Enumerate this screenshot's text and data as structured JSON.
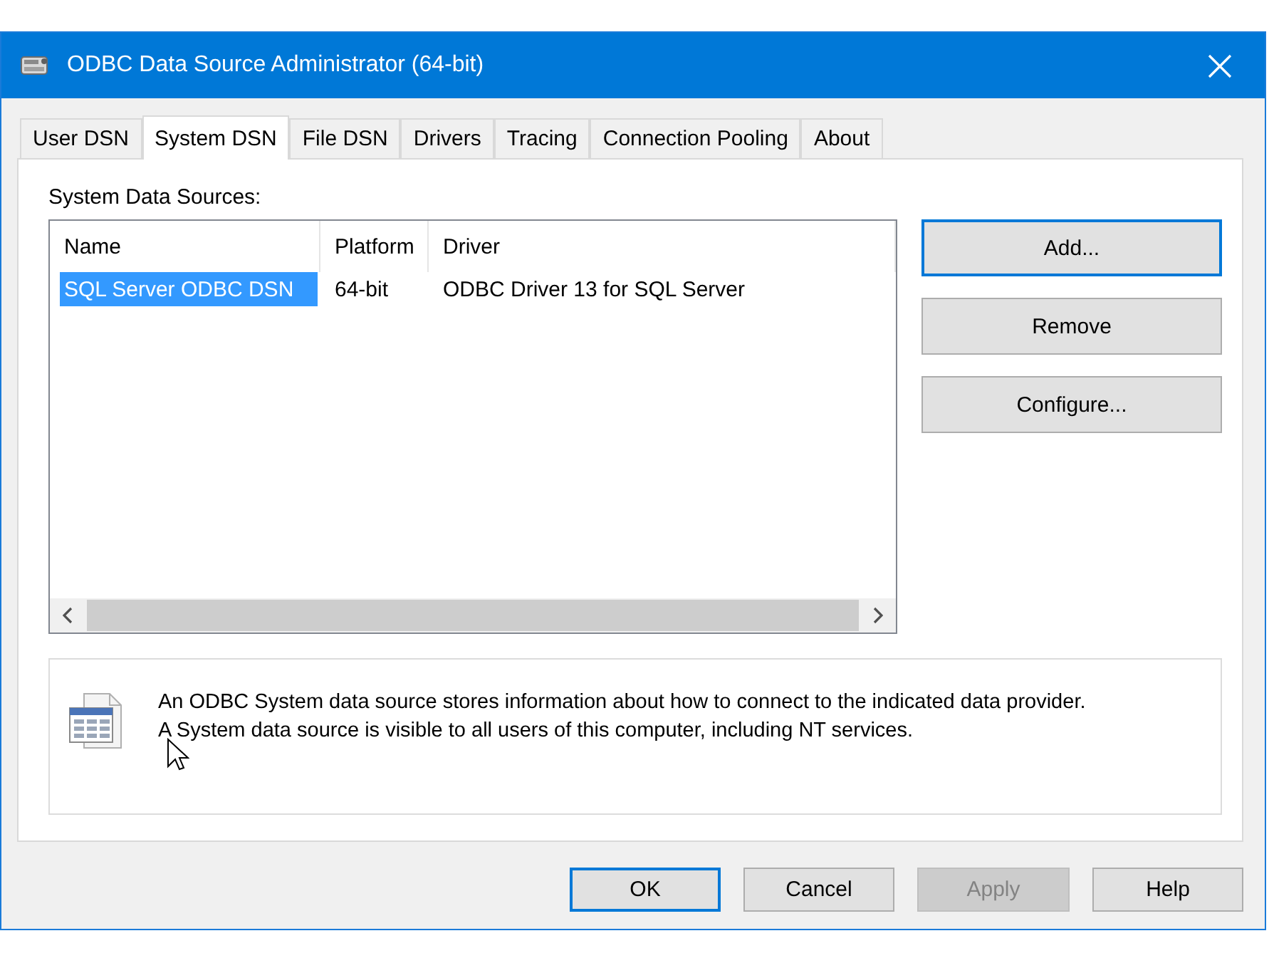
{
  "window": {
    "title": "ODBC Data Source Administrator (64-bit)"
  },
  "tabs": [
    {
      "label": "User DSN",
      "selected": false
    },
    {
      "label": "System DSN",
      "selected": true
    },
    {
      "label": "File DSN",
      "selected": false
    },
    {
      "label": "Drivers",
      "selected": false
    },
    {
      "label": "Tracing",
      "selected": false
    },
    {
      "label": "Connection Pooling",
      "selected": false
    },
    {
      "label": "About",
      "selected": false
    }
  ],
  "list": {
    "label": "System Data Sources:",
    "columns": [
      "Name",
      "Platform",
      "Driver"
    ],
    "rows": [
      {
        "cells": [
          "SQL Server ODBC DSN",
          "64-bit",
          "ODBC Driver 13 for SQL Server"
        ],
        "selected": true
      }
    ]
  },
  "side_buttons": [
    {
      "label": "Add...",
      "default": true
    },
    {
      "label": "Remove",
      "default": false
    },
    {
      "label": "Configure...",
      "default": false
    }
  ],
  "description": [
    "An ODBC System data source stores information about how to connect to the indicated data provider.",
    "A System data source is visible to all users of this computer, including NT services."
  ],
  "buttons": [
    {
      "label": "OK",
      "default": true,
      "disabled": false
    },
    {
      "label": "Cancel",
      "default": false,
      "disabled": false
    },
    {
      "label": "Apply",
      "default": false,
      "disabled": true
    },
    {
      "label": "Help",
      "default": false,
      "disabled": false
    }
  ]
}
